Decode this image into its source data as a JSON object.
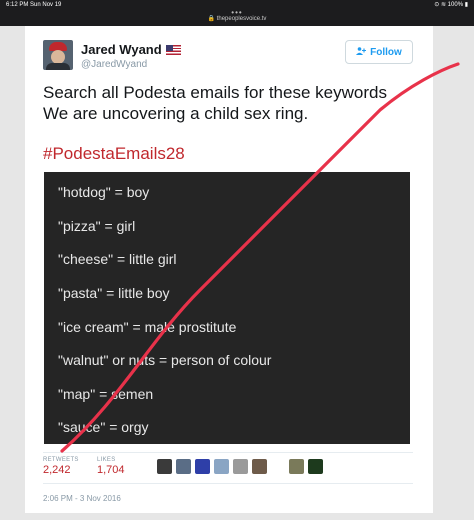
{
  "status_bar": {
    "time": "6:12 PM  Sun Nov 19",
    "right": "⊙ ≋ 100% ▮"
  },
  "browser": {
    "dots": "•••",
    "url": "🔒 thepeoplesvoice.tv"
  },
  "tweet": {
    "name": "Jared Wyand",
    "handle": "@JaredWyand",
    "follow_label": "Follow",
    "text_lines": [
      "Search all Podesta emails for these keywords",
      "We are uncovering a child sex ring."
    ],
    "hashtag": "#PodestaEmails28",
    "image_lines": [
      "\"hotdog\" = boy",
      "\"pizza\" = girl",
      "\"cheese\" = little girl",
      "\"pasta\" = little boy",
      "\"ice cream\" = male prostitute",
      "\"walnut\" or nuts = person of colour",
      "\"map\" = semen",
      "\"sauce\" = orgy"
    ],
    "retweets_label": "RETWEETS",
    "retweets": "2,242",
    "likes_label": "LIKES",
    "likes": "1,704",
    "timestamp": "2:06 PM - 3 Nov 2016"
  },
  "colors": {
    "accent_red": "#c0282d",
    "follow_blue": "#1d9bf0",
    "image_bg": "#252525"
  },
  "icons": [
    "person-plus-icon",
    "us-flag-icon"
  ]
}
